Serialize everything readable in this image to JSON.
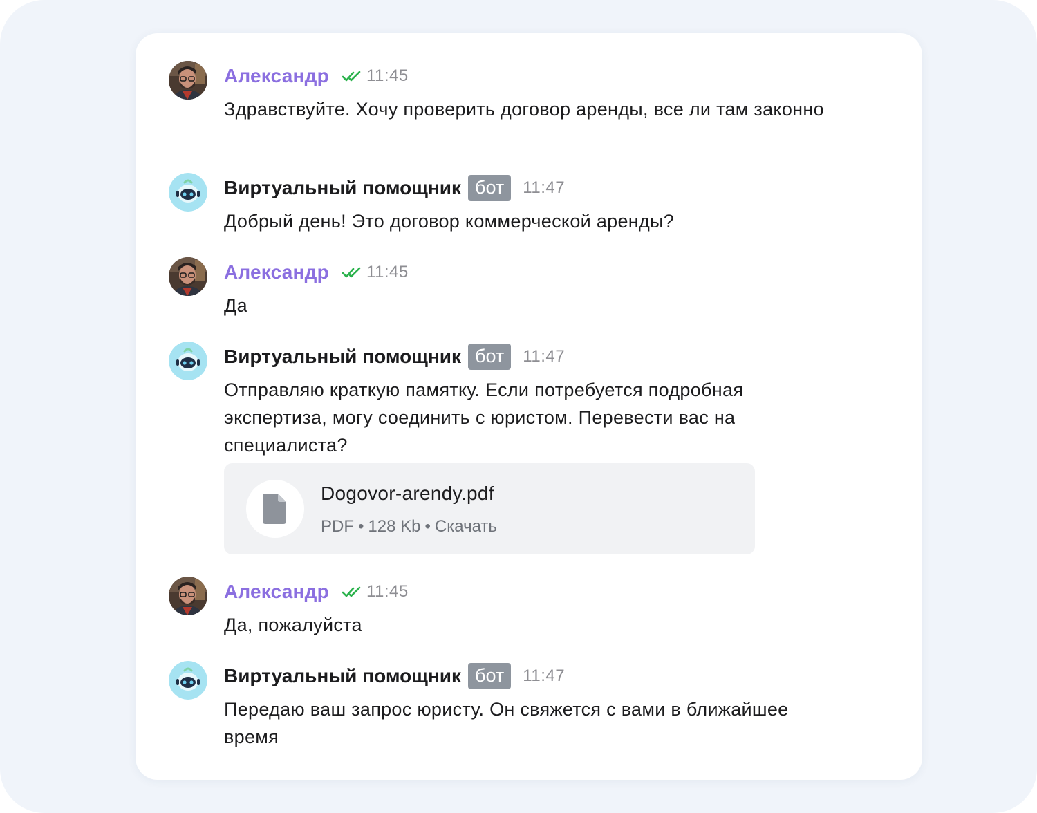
{
  "messages": [
    {
      "kind": "user",
      "avatar_icon": "user-avatar",
      "author": "Александр",
      "status_icon": "double-check-icon",
      "time": "11:45",
      "text": "Здравствуйте. Хочу проверить договор аренды, все ли там законно"
    },
    {
      "kind": "bot",
      "avatar_icon": "robot-avatar",
      "author": "Виртуальный помощник",
      "badge": "бот",
      "time": "11:47",
      "text": "Добрый день! Это договор коммерческой аренды?"
    },
    {
      "kind": "user",
      "avatar_icon": "user-avatar",
      "author": "Александр",
      "status_icon": "double-check-icon",
      "time": "11:45",
      "text": "Да"
    },
    {
      "kind": "bot",
      "avatar_icon": "robot-avatar",
      "author": "Виртуальный помощник",
      "badge": "бот",
      "time": "11:47",
      "text": "Отправляю краткую памятку. Если потребуется подробная экспертиза, могу соединить с юристом. Перевести вас на специалиста?",
      "attachment": {
        "icon": "file-icon",
        "name": "Dogovor-arendy.pdf",
        "type": "PDF",
        "separator": "•",
        "size": "128 Kb",
        "action": "Скачать"
      }
    },
    {
      "kind": "user",
      "avatar_icon": "user-avatar",
      "author": "Александр",
      "status_icon": "double-check-icon",
      "time": "11:45",
      "text": "Да, пожалуйста"
    },
    {
      "kind": "bot",
      "avatar_icon": "robot-avatar",
      "author": "Виртуальный помощник",
      "badge": "бот",
      "time": "11:47",
      "text": "Передаю ваш запрос юристу. Он свяжется с вами в ближайшее время"
    }
  ],
  "colors": {
    "user_name": "#8b6fe0",
    "check": "#2bb24c",
    "badge_bg": "#8e959e",
    "page_bg": "#f0f4fa",
    "robot_bg": "#a6e3f2"
  }
}
